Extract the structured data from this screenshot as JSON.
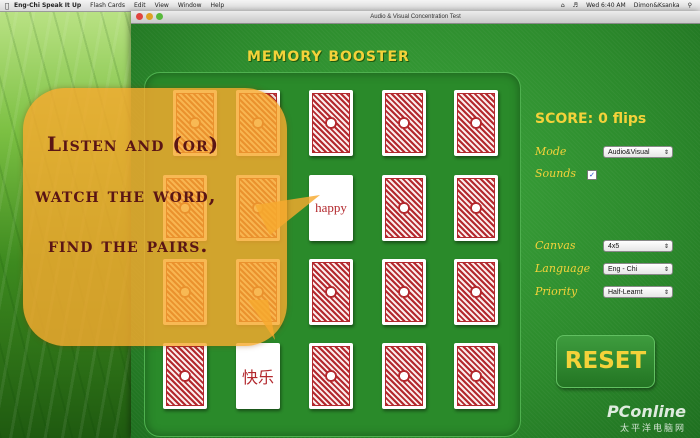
{
  "menubar": {
    "app_name": "Eng-Chi Speak It Up",
    "items": [
      "Flash Cards",
      "Edit",
      "View",
      "Window",
      "Help"
    ],
    "clock": "Wed 6:40 AM",
    "user": "Dimon&Ksanka"
  },
  "window": {
    "title": "Audio & Visual Concentration Test"
  },
  "app_title": "MEMORY BOOSTER",
  "cards": [
    [
      "back",
      "back",
      "back",
      "back",
      "back"
    ],
    [
      "back",
      "back",
      "happy",
      "back",
      "back"
    ],
    [
      "back",
      "back",
      "back",
      "back",
      "back"
    ],
    [
      "back",
      "快乐",
      "back",
      "back",
      "back"
    ]
  ],
  "score": {
    "label": "SCORE:",
    "value": "0 flips"
  },
  "settings": {
    "mode_label": "Mode",
    "mode_value": "Audio&Visual",
    "sounds_label": "Sounds",
    "sounds_checked": "✓",
    "canvas_label": "Canvas",
    "canvas_value": "4x5",
    "language_label": "Language",
    "language_value": "Eng - Chi",
    "priority_label": "Priority",
    "priority_value": "Half-Learnt"
  },
  "reset_label": "RESET",
  "bubble": {
    "line1": "Listen and (or)",
    "line2": "watch the  word,",
    "line3": "find the pairs."
  },
  "watermark": {
    "line1": "PConline",
    "line2": "太平洋电脑网"
  },
  "colors": {
    "accent": "#f4d23a",
    "felt": "#2f8f2f",
    "card_red": "#b3282d",
    "bubble": "#f6aa2e"
  }
}
